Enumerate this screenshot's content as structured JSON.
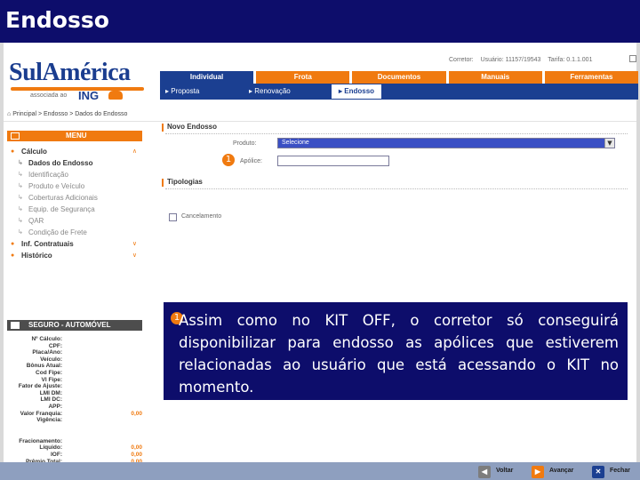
{
  "slide": {
    "title": "Endosso"
  },
  "brand": {
    "name": "SulAmérica",
    "assoc": "associada ao",
    "partner": "ING"
  },
  "toplinks": [
    "Corretor:",
    "Usuário: 11157/19543",
    "Tarifa: 0.1.1.001"
  ],
  "tabs": [
    "Individual",
    "Frota",
    "Documentos",
    "Manuais",
    "Ferramentas"
  ],
  "subnav": {
    "proposta": "Proposta",
    "renovacao": "Renovação",
    "endosso": "Endosso"
  },
  "breadcrumb": "Principal > Endosso > Dados do Endosso",
  "menu": {
    "header": "MENU",
    "items": [
      {
        "label": "Cálculo"
      },
      {
        "label": "Dados do Endosso",
        "sub": true,
        "bold": true
      },
      {
        "label": "Identificação",
        "sub": true
      },
      {
        "label": "Produto e Veículo",
        "sub": true
      },
      {
        "label": "Coberturas Adicionais",
        "sub": true
      },
      {
        "label": "Equip. de Segurança",
        "sub": true
      },
      {
        "label": "QAR",
        "sub": true
      },
      {
        "label": "Condição de Frete",
        "sub": true
      },
      {
        "label": "Inf. Contratuais"
      },
      {
        "label": "Histórico"
      }
    ]
  },
  "seguro": {
    "header": "SEGURO - AUTOMÓVEL",
    "rows": [
      {
        "k": "Nº Cálculo:",
        "v": ""
      },
      {
        "k": "CPF:",
        "v": ""
      },
      {
        "k": "Placa/Ano:",
        "v": ""
      },
      {
        "k": "Veículo:",
        "v": ""
      },
      {
        "k": "Bônus Atual:",
        "v": ""
      },
      {
        "k": "Cod Fipe:",
        "v": ""
      },
      {
        "k": "Vl Fipe:",
        "v": ""
      },
      {
        "k": "Fator de Ajuste:",
        "v": ""
      },
      {
        "k": "LMI DM:",
        "v": ""
      },
      {
        "k": "LMI DC:",
        "v": ""
      },
      {
        "k": "APP:",
        "v": ""
      },
      {
        "k": "Valor Franquia:",
        "v": "0,00"
      },
      {
        "k": "Vigência:",
        "v": ""
      }
    ],
    "totals": [
      {
        "k": "Fracionamento:",
        "v": ""
      },
      {
        "k": "Líquido:",
        "v": "0,00"
      },
      {
        "k": "IOF:",
        "v": "0,00"
      },
      {
        "k": "Prêmio Total:",
        "v": "0,00"
      }
    ]
  },
  "form": {
    "novo_endosso": "Novo Endosso",
    "produto_label": "Produto:",
    "produto_value": "Selecione",
    "apolice_label": "Apólice:",
    "apolice_value": "",
    "tipologias": "Tipologias",
    "cancelamento_label": "Cancelamento"
  },
  "callout": {
    "badge": "1",
    "text": "Assim como no KIT OFF, o corretor só conseguirá disponibilizar para endosso as apólices que estiverem relacionadas ao usuário que está acessando o KIT no momento."
  },
  "marker": {
    "badge": "1"
  },
  "footer": {
    "voltar": "Voltar",
    "avancar": "Avançar",
    "fechar": "Fechar"
  },
  "colors": {
    "navy": "#0d0d6b",
    "orange": "#f07a10",
    "blue": "#1b3f91"
  }
}
